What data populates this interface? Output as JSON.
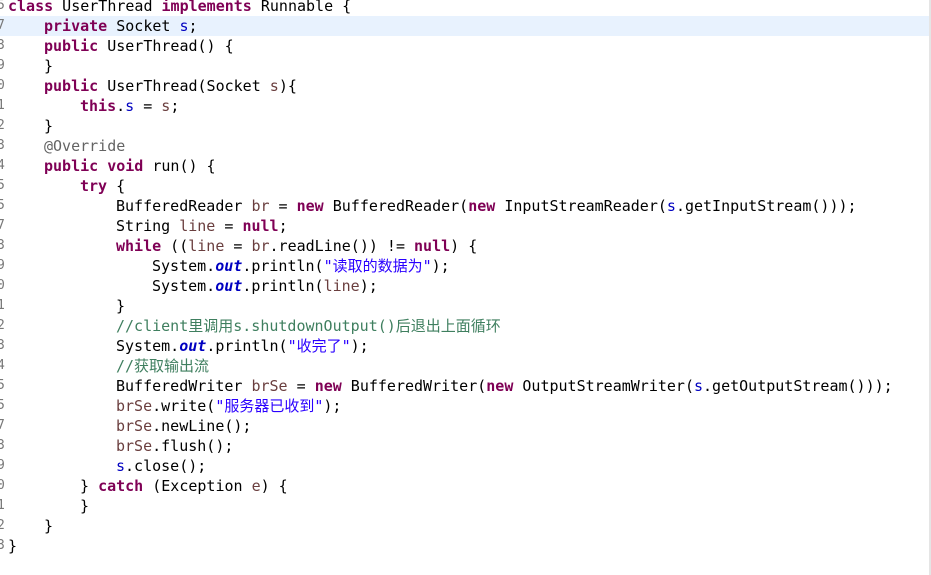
{
  "editor": {
    "language": "java",
    "current_line": 2,
    "colors": {
      "keyword": "#7f0055",
      "field": "#0000c0",
      "local_variable": "#6a3e3e",
      "string": "#2a00ff",
      "comment": "#3f7f5f",
      "annotation": "#646464",
      "current_line_highlight": "#e8f2fe",
      "line_number": "#787878"
    },
    "lines": [
      {
        "number": "5",
        "indent": 0,
        "tokens": [
          {
            "t": "class",
            "c": "kw"
          },
          {
            "t": " UserThread "
          },
          {
            "t": "implements",
            "c": "kw"
          },
          {
            "t": " Runnable {"
          }
        ]
      },
      {
        "number": "7",
        "indent": 4,
        "tokens": [
          {
            "t": "private",
            "c": "kw"
          },
          {
            "t": " Socket "
          },
          {
            "t": "s",
            "c": "field"
          },
          {
            "t": ";"
          }
        ]
      },
      {
        "number": "3",
        "indent": 4,
        "tokens": [
          {
            "t": "public",
            "c": "kw"
          },
          {
            "t": " UserThread() {"
          }
        ]
      },
      {
        "number": "9",
        "indent": 4,
        "tokens": [
          {
            "t": "}"
          }
        ]
      },
      {
        "number": "0",
        "indent": 4,
        "tokens": [
          {
            "t": "public",
            "c": "kw"
          },
          {
            "t": " UserThread(Socket "
          },
          {
            "t": "s",
            "c": "var"
          },
          {
            "t": "){"
          }
        ]
      },
      {
        "number": "1",
        "indent": 8,
        "tokens": [
          {
            "t": "this",
            "c": "kw"
          },
          {
            "t": "."
          },
          {
            "t": "s",
            "c": "field"
          },
          {
            "t": " = "
          },
          {
            "t": "s",
            "c": "var"
          },
          {
            "t": ";"
          }
        ]
      },
      {
        "number": "2",
        "indent": 4,
        "tokens": [
          {
            "t": "}"
          }
        ]
      },
      {
        "number": "3",
        "indent": 4,
        "tokens": [
          {
            "t": "@Override",
            "c": "ann"
          }
        ]
      },
      {
        "number": "4",
        "indent": 4,
        "tokens": [
          {
            "t": "public",
            "c": "kw"
          },
          {
            "t": " "
          },
          {
            "t": "void",
            "c": "kw"
          },
          {
            "t": " run() {"
          }
        ]
      },
      {
        "number": "5",
        "indent": 8,
        "tokens": [
          {
            "t": "try",
            "c": "kw"
          },
          {
            "t": " {"
          }
        ]
      },
      {
        "number": "5",
        "indent": 12,
        "tokens": [
          {
            "t": "BufferedReader "
          },
          {
            "t": "br",
            "c": "var"
          },
          {
            "t": " = "
          },
          {
            "t": "new",
            "c": "kw"
          },
          {
            "t": " BufferedReader("
          },
          {
            "t": "new",
            "c": "kw"
          },
          {
            "t": " InputStreamReader("
          },
          {
            "t": "s",
            "c": "field"
          },
          {
            "t": ".getInputStream()));"
          }
        ]
      },
      {
        "number": "7",
        "indent": 12,
        "tokens": [
          {
            "t": "String "
          },
          {
            "t": "line",
            "c": "var"
          },
          {
            "t": " = "
          },
          {
            "t": "null",
            "c": "kw"
          },
          {
            "t": ";"
          }
        ]
      },
      {
        "number": "3",
        "indent": 12,
        "tokens": [
          {
            "t": "while",
            "c": "kw"
          },
          {
            "t": " (("
          },
          {
            "t": "line",
            "c": "var"
          },
          {
            "t": " = "
          },
          {
            "t": "br",
            "c": "var"
          },
          {
            "t": ".readLine()) != "
          },
          {
            "t": "null",
            "c": "kw"
          },
          {
            "t": ") {"
          }
        ]
      },
      {
        "number": "9",
        "indent": 16,
        "tokens": [
          {
            "t": "System."
          },
          {
            "t": "out",
            "c": "sfield"
          },
          {
            "t": ".println("
          },
          {
            "t": "\"读取的数据为\"",
            "c": "str"
          },
          {
            "t": ");"
          }
        ]
      },
      {
        "number": "0",
        "indent": 16,
        "tokens": [
          {
            "t": "System."
          },
          {
            "t": "out",
            "c": "sfield"
          },
          {
            "t": ".println("
          },
          {
            "t": "line",
            "c": "var"
          },
          {
            "t": ");"
          }
        ]
      },
      {
        "number": "1",
        "indent": 12,
        "tokens": [
          {
            "t": "}"
          }
        ]
      },
      {
        "number": "2",
        "indent": 12,
        "tokens": [
          {
            "t": "//client里调用s.shutdownOutput()后退出上面循环",
            "c": "cm"
          }
        ]
      },
      {
        "number": "3",
        "indent": 12,
        "tokens": [
          {
            "t": "System."
          },
          {
            "t": "out",
            "c": "sfield"
          },
          {
            "t": ".println("
          },
          {
            "t": "\"收完了\"",
            "c": "str"
          },
          {
            "t": ");"
          }
        ]
      },
      {
        "number": "4",
        "indent": 12,
        "tokens": [
          {
            "t": "//获取输出流",
            "c": "cm"
          }
        ]
      },
      {
        "number": "5",
        "indent": 12,
        "tokens": [
          {
            "t": "BufferedWriter "
          },
          {
            "t": "brSe",
            "c": "var"
          },
          {
            "t": " = "
          },
          {
            "t": "new",
            "c": "kw"
          },
          {
            "t": " BufferedWriter("
          },
          {
            "t": "new",
            "c": "kw"
          },
          {
            "t": " OutputStreamWriter("
          },
          {
            "t": "s",
            "c": "field"
          },
          {
            "t": ".getOutputStream()));"
          }
        ]
      },
      {
        "number": "5",
        "indent": 12,
        "tokens": [
          {
            "t": "brSe",
            "c": "var"
          },
          {
            "t": ".write("
          },
          {
            "t": "\"服务器已收到\"",
            "c": "str"
          },
          {
            "t": ");"
          }
        ]
      },
      {
        "number": "7",
        "indent": 12,
        "tokens": [
          {
            "t": "brSe",
            "c": "var"
          },
          {
            "t": ".newLine();"
          }
        ]
      },
      {
        "number": "3",
        "indent": 12,
        "tokens": [
          {
            "t": "brSe",
            "c": "var"
          },
          {
            "t": ".flush();"
          }
        ]
      },
      {
        "number": "9",
        "indent": 12,
        "tokens": [
          {
            "t": "s",
            "c": "field"
          },
          {
            "t": ".close();"
          }
        ]
      },
      {
        "number": "0",
        "indent": 8,
        "tokens": [
          {
            "t": "} "
          },
          {
            "t": "catch",
            "c": "kw"
          },
          {
            "t": " (Exception "
          },
          {
            "t": "e",
            "c": "var"
          },
          {
            "t": ") {"
          }
        ]
      },
      {
        "number": "1",
        "indent": 8,
        "tokens": [
          {
            "t": "}"
          }
        ]
      },
      {
        "number": "2",
        "indent": 4,
        "tokens": [
          {
            "t": "}"
          }
        ]
      },
      {
        "number": "3",
        "indent": 0,
        "tokens": [
          {
            "t": "}"
          }
        ]
      }
    ]
  }
}
